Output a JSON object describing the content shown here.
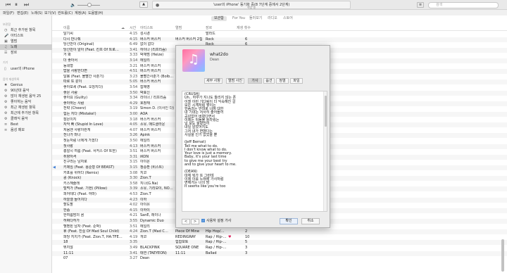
{
  "toolbar": {
    "lcd_title": "'user의 iPhone' 동기화 중(8 7단계 중에서 2단계)",
    "lcd_sub": "백업 중",
    "search_placeholder": "검색",
    "logo": "",
    "icons": [
      "back-icon",
      "play-pause-icon",
      "forward-icon",
      "volume-icon",
      "airplay-icon",
      "apple-logo-icon",
      "list-icon",
      "search-icon"
    ]
  },
  "menus": [
    "파일(F)",
    "편집(E)",
    "노래(S)",
    "보기(V)",
    "컨트롤(C)",
    "계정(A)",
    "도움말(H)"
  ],
  "sidebar": {
    "library_head": "보관함",
    "library": [
      {
        "icon": "clock-icon",
        "label": "최근 추가된 항목"
      },
      {
        "icon": "mic-icon",
        "label": "아티스트"
      },
      {
        "icon": "album-icon",
        "label": "앨범"
      },
      {
        "icon": "note-icon",
        "label": "노래"
      },
      {
        "icon": "genre-icon",
        "label": "장르"
      }
    ],
    "device_head": "기기",
    "device": {
      "icon": "phone-icon",
      "label": "user의 iPhone"
    },
    "playlists_head": "음악 재생목록",
    "playlists": [
      {
        "icon": "genius-icon",
        "label": "Genius"
      },
      {
        "icon": "gear-icon",
        "label": "90년대 음악"
      },
      {
        "icon": "gear-icon",
        "label": "많이 재생된 음악 25"
      },
      {
        "icon": "gear-icon",
        "label": "좋아하는 음악"
      },
      {
        "icon": "gear-icon",
        "label": "최근 재생된 항목"
      },
      {
        "icon": "gear-icon",
        "label": "최근에 추가된 항목"
      },
      {
        "icon": "gear-icon",
        "label": "클래식 음악"
      },
      {
        "icon": "list-icon",
        "label": "Best"
      },
      {
        "icon": "list-icon",
        "label": "음성 메모"
      }
    ]
  },
  "main": {
    "tabs": [
      "보관함",
      "For You",
      "둘러보기",
      "라디오",
      "스토어"
    ],
    "selected_tab": "보관함",
    "columns": [
      "이름",
      "시간",
      "아티스트",
      "앨범",
      "장르",
      "",
      "재생 횟수"
    ],
    "rows": [
      {
        "name": "달기씨",
        "time": "4:15",
        "artist": "성시경",
        "album": "",
        "genre": "발라드",
        "heart": "",
        "plays": ""
      },
      {
        "name": "다시 만나줘",
        "time": "4:15",
        "artist": "버스커 버스커",
        "album": "버스커 버스커 2집",
        "genre": "Rock",
        "heart": "",
        "plays": "6"
      },
      {
        "name": "당신만이 (Original)",
        "time": "6:49",
        "artist": "없이 없다",
        "album": "",
        "genre": "Rock",
        "heart": "",
        "plays": "6"
      },
      {
        "name": "당신만이 알아 (Feat. 킨프 Of 트로…",
        "time": "3:41",
        "artist": "하이나 (리프리즘)",
        "album": "",
        "genre": "",
        "heart": "",
        "plays": ""
      },
      {
        "name": "거 봐",
        "time": "3:33",
        "artist": "박재범 (Heize)",
        "album": "",
        "genre": "",
        "heart": "",
        "plays": ""
      },
      {
        "name": "더 좋아서",
        "time": "3:14",
        "artist": "에일리",
        "album": "",
        "genre": "",
        "heart": "",
        "plays": ""
      },
      {
        "name": "동네형",
        "time": "3:21",
        "artist": "버스커 버스커",
        "album": "",
        "genre": "",
        "heart": "",
        "plays": ""
      },
      {
        "name": "맙을 사랑한다면",
        "time": "4:51",
        "artist": "버스커 버스커",
        "album": "",
        "genre": "",
        "heart": "",
        "plays": ""
      },
      {
        "name": "달봉 (Feat. 볼빨간 사춘기)",
        "time": "3:23",
        "artist": "볼빨간사춘기 (Bolb…",
        "album": "",
        "genre": "",
        "heart": "",
        "plays": ""
      },
      {
        "name": "따로 또 같이",
        "time": "5:05",
        "artist": "버스커 버스커",
        "album": "",
        "genre": "",
        "heart": "",
        "plays": ""
      },
      {
        "name": "좋아보세 (Feat. 오칭지다)",
        "time": "3:54",
        "artist": "잡채영",
        "album": "",
        "genre": "",
        "heart": "",
        "plays": ""
      },
      {
        "name": "좋은 사람",
        "time": "3:50",
        "artist": "박효신",
        "album": "",
        "genre": "",
        "heart": "",
        "plays": ""
      },
      {
        "name": "좋아요 (Guilty)",
        "time": "3:34",
        "artist": "라이너 / 리프리즘",
        "album": "",
        "genre": "",
        "heart": "",
        "plays": ""
      },
      {
        "name": "좋아하는 사람",
        "time": "4:29",
        "artist": "호창재",
        "album": "",
        "genre": "",
        "heart": "",
        "plays": ""
      },
      {
        "name": "전략 (Cheerz)",
        "time": "3:19",
        "artist": "Simon D. (이사인 다)",
        "album": "",
        "genre": "",
        "heart": "",
        "plays": ""
      },
      {
        "name": "힘든 지다 (Mistake!)",
        "time": "3:00",
        "artist": "AOA",
        "album": "",
        "genre": "",
        "heart": "",
        "plays": ""
      },
      {
        "name": "잠은이지",
        "time": "3:18",
        "artist": "버스커 버스커",
        "album": "",
        "genre": "",
        "heart": "",
        "plays": ""
      },
      {
        "name": "자악 빠 (Stupid In Love)",
        "time": "4:05",
        "artist": "소유, 매드클라운",
        "album": "",
        "genre": "",
        "heart": "",
        "plays": ""
      },
      {
        "name": "처음엔 사랑이란게",
        "time": "4:07",
        "artist": "버스커 버스커",
        "album": "",
        "genre": "",
        "heart": "",
        "plays": ""
      },
      {
        "name": "전나가 마나",
        "time": "3:26",
        "artist": "Apink",
        "album": "",
        "genre": "",
        "heart": "",
        "plays": ""
      },
      {
        "name": "첫눈처럼 너에게 가겠다",
        "time": "3:50",
        "artist": "에일리",
        "album": "",
        "genre": "",
        "heart": "",
        "plays": ""
      },
      {
        "name": "첫사랑",
        "time": "4:13",
        "artist": "버스커 버스커",
        "album": "",
        "genre": "",
        "heart": "",
        "plays": ""
      },
      {
        "name": "총알시 여름 (Feat. 서커스 Of 트한)",
        "time": "3:51",
        "artist": "버스커 버스커",
        "album": "",
        "genre": "",
        "heart": "",
        "plays": ""
      },
      {
        "name": "취향저격",
        "time": "3:31",
        "artist": "iKON",
        "album": "",
        "genre": "",
        "heart": "",
        "plays": ""
      },
      {
        "name": "친구라는 남자로",
        "time": "3:15",
        "artist": "아이온",
        "album": "",
        "genre": "",
        "heart": "",
        "plays": ""
      },
      {
        "name": "키제임 (Feat. 용준형 Of BEAST)",
        "time": "3:15",
        "artist": "정승환 (비스트)",
        "album": "",
        "genre": "",
        "heart": "",
        "plays": ""
      },
      {
        "name": "카포를 위하다 (Remix)",
        "time": "3:08",
        "artist": "지코",
        "album": "",
        "genre": "",
        "heart": "",
        "plays": ""
      },
      {
        "name": "콩 (Knock)",
        "time": "3:30",
        "artist": "Zion.T",
        "album": "",
        "genre": "",
        "heart": "",
        "plays": ""
      },
      {
        "name": "키스해줄래",
        "time": "3:58",
        "artist": "지나(G.Na)",
        "album": "",
        "genre": "",
        "heart": "",
        "plays": ""
      },
      {
        "name": "털먹가 (Feat. 기현) (Pillow)",
        "time": "3:39",
        "artist": "소유, 기리보이, NO…",
        "album": "",
        "genre": "",
        "heart": "",
        "plays": ""
      },
      {
        "name": "피어테디 (Feat. 하마)",
        "time": "4:53",
        "artist": "Zion.T",
        "album": "",
        "genre": "",
        "heart": "",
        "plays": ""
      },
      {
        "name": "하늘엘 들어치다",
        "time": "4:23",
        "artist": "이하",
        "album": "",
        "genre": "",
        "heart": "",
        "plays": ""
      },
      {
        "name": "할도할",
        "time": "4:02",
        "artist": "아이유",
        "album": "",
        "genre": "",
        "heart": "",
        "plays": ""
      },
      {
        "name": "한숨",
        "time": "4:15",
        "artist": "이하이",
        "album": "",
        "genre": "",
        "heart": "",
        "plays": ""
      },
      {
        "name": "한여름밤의 꿈",
        "time": "4:21",
        "artist": "SanE, 레이나",
        "album": "",
        "genre": "",
        "heart": "",
        "plays": ""
      },
      {
        "name": "허쩌다허가",
        "time": "3:55",
        "artist": "Dynamic Duo",
        "album": "",
        "genre": "",
        "heart": "",
        "plays": "28"
      },
      {
        "name": "헬벤된 남자 (Feat. 준박)",
        "time": "3:51",
        "artist": "에일리",
        "album": "",
        "genre": "",
        "heart": "",
        "plays": "10"
      },
      {
        "name": "휴 (Feat. 진실 Of Mad Soul Child)",
        "time": "4:24",
        "artist": "Zion.T (Mad C…",
        "album": "Piece Of Mine",
        "genre": "Hip Hop/…",
        "heart": "",
        "plays": "2"
      },
      {
        "name": "파당 지치가 (Feat. Zion.T, HA:TFE…",
        "time": "4:19",
        "artist": "개코",
        "album": "REDINGRAY",
        "genre": "Rap / Hip-…",
        "heart": "♥",
        "plays": "10"
      },
      {
        "name": "18",
        "time": "3:35",
        "artist": "",
        "album": "힙합보토",
        "genre": "Rap / Hip-…",
        "heart": "",
        "plays": "5"
      },
      {
        "name": "뛰지않",
        "time": "3:49",
        "artist": "BLACKPINK",
        "album": "SQUARE ONE",
        "genre": "Rap / Hip-…",
        "heart": "",
        "plays": "3"
      },
      {
        "name": "11:11",
        "time": "3:41",
        "artist": "태연 (TAEYEON)",
        "album": "11:11",
        "genre": "Ballad",
        "heart": "",
        "plays": "3"
      },
      {
        "name": "07",
        "time": "3:27",
        "artist": "Dean",
        "album": "",
        "genre": "",
        "heart": "",
        "plays": ""
      }
    ]
  },
  "dialog": {
    "song_title": "what2do",
    "song_artist": "Dean",
    "art_icon": "music-note-icon",
    "tabs": [
      "세부 사항",
      "앨범 사진",
      "가사",
      "옵션",
      "정렬",
      "파일"
    ],
    "selected_tab": "가사",
    "lyrics": [
      "(CRUSH)",
      "Uh.. 하루가 지나도 들리지 않는 폰",
      "이젠 이런 기다림이 더 익숙해진 걸",
      "모든 시계처럼 쌓이는",
      "한숨과는 반대로 너에 대한",
      "내 기대는 서서히 줄어들어",
      "공감없어 버렸다면서",
      "이제는 뒤돌볼 놀라웠는",
      "널 보도 울렸었어",
      "내일 알았어지도",
      "그저 내가 변했다는",
      "사실을 인기 없었을 뿐",
      "",
      "(Jeff Bernat)",
      "Tell me what to do.",
      "I don't know what to do.",
      "Your love is just a memory.",
      "Baby, it's your last time",
      "to give me your best try",
      "and to give your heart to me.",
      "",
      "(DEAN)",
      "대체 뭐가 또 그런데",
      "이제 이를 노래에 가사처럼",
      "변해가는 너의 밤",
      "It seems like you're too"
    ],
    "custom_lyrics_label": "사용자 설정 가사",
    "prev_label": "<",
    "next_label": ">",
    "ok_label": "확인",
    "cancel_label": "취소"
  }
}
